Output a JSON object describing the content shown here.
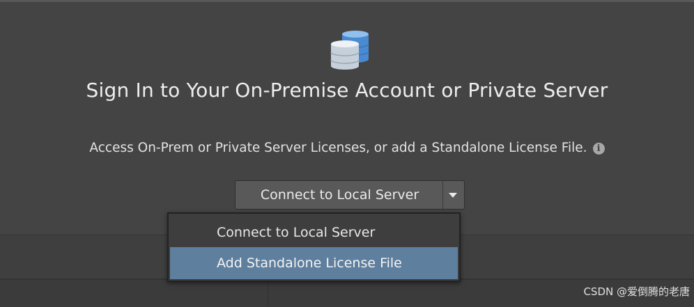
{
  "dialog": {
    "title": "Sign In to Your On-Premise Account or Private Server",
    "subtitle": "Access On-Prem or Private Server Licenses, or add a Standalone License File.",
    "icon": "database-icon",
    "info_icon": "info-icon",
    "info_glyph": "i"
  },
  "split_button": {
    "label": "Connect to Local Server",
    "arrow_icon": "chevron-down-icon"
  },
  "dropdown": {
    "items": [
      {
        "label": "Connect to Local Server",
        "highlighted": false
      },
      {
        "label": "Add Standalone License File",
        "highlighted": true
      }
    ]
  },
  "colors": {
    "background": "#444444",
    "button": "#595959",
    "highlight": "#5f7f9e",
    "icon_blue": "#4f8fd4",
    "icon_light": "#c8d3de"
  },
  "watermark": {
    "text": "CSDN @爱倒腾的老唐"
  }
}
